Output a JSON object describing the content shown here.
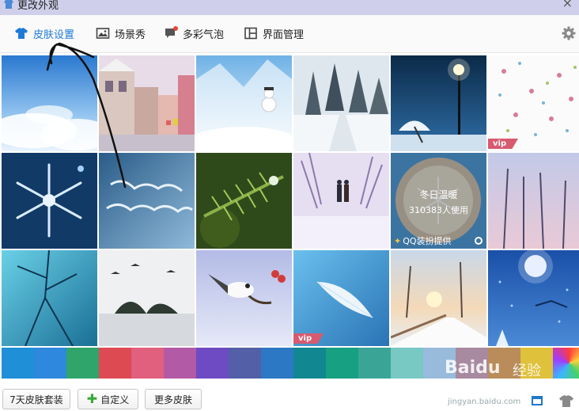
{
  "window": {
    "title": "更改外观",
    "close_glyph": "×"
  },
  "tabs": [
    {
      "label": "皮肤设置",
      "icon": "tshirt-icon",
      "active": true
    },
    {
      "label": "场景秀",
      "icon": "picture-icon",
      "active": false
    },
    {
      "label": "多彩气泡",
      "icon": "chat-bubble-icon",
      "active": false,
      "badge": true
    },
    {
      "label": "界面管理",
      "icon": "layout-icon",
      "active": false
    }
  ],
  "skins": [
    {
      "name": "snow-cloud-sky"
    },
    {
      "name": "snowy-street"
    },
    {
      "name": "snowman"
    },
    {
      "name": "snow-forest-road"
    },
    {
      "name": "snow-umbrella-lamp"
    },
    {
      "name": "snowflake-pattern",
      "vip": "vip"
    },
    {
      "name": "ice-snowflake"
    },
    {
      "name": "merry-christmas-frost"
    },
    {
      "name": "pine-branch"
    },
    {
      "name": "couple-snow-walk"
    },
    {
      "name": "featured-cocoa",
      "featured": true
    },
    {
      "name": "winter-trees"
    },
    {
      "name": "frost-branch"
    },
    {
      "name": "snow-lake"
    },
    {
      "name": "bird-on-branch"
    },
    {
      "name": "white-feather",
      "vip": "vip"
    },
    {
      "name": "snowy-bridge-sunset"
    },
    {
      "name": "moon-night-sleigh"
    }
  ],
  "featured": {
    "title": "冬日温暖",
    "count": "310383人使用",
    "provider": "QQ装扮提供"
  },
  "swatches": [
    "#1f8fd8",
    "#2e88dd",
    "#2fa56b",
    "#de4a52",
    "#e0607d",
    "#b25aa6",
    "#6e4bc3",
    "#535fa6",
    "#2c78c4",
    "#118891",
    "#18a083",
    "#3aa597",
    "#78c8c4",
    "#99bbdb",
    "#a78aa0",
    "#b98c5a",
    "#dfc13c",
    "#c9c9c9"
  ],
  "buttons": {
    "suite": "7天皮肤套装",
    "custom": "自定义",
    "more": "更多皮肤"
  },
  "watermark": {
    "brand": "Baidu",
    "jy": "经验",
    "url": "jingyan.baidu.com"
  },
  "colors": {
    "accent": "#1f7ad6",
    "vip": "#d85a6f"
  }
}
